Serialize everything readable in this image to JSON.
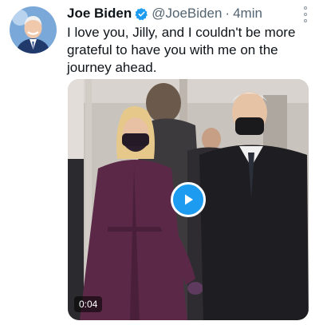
{
  "tweet": {
    "author_name": "Joe Biden",
    "handle": "@JoeBiden",
    "separator": "·",
    "time": "4min",
    "verified": true,
    "text": "I love you, Jilly, and I couldn't be more grateful to have you with me on the journey ahead."
  },
  "media": {
    "duration": "0:04"
  },
  "icons": {
    "verified": "verified-badge-icon",
    "more": "more-options-icon",
    "play": "play-icon"
  },
  "colors": {
    "accent": "#1d9bf0",
    "text": "#0f1419",
    "secondary_text": "#536471"
  }
}
